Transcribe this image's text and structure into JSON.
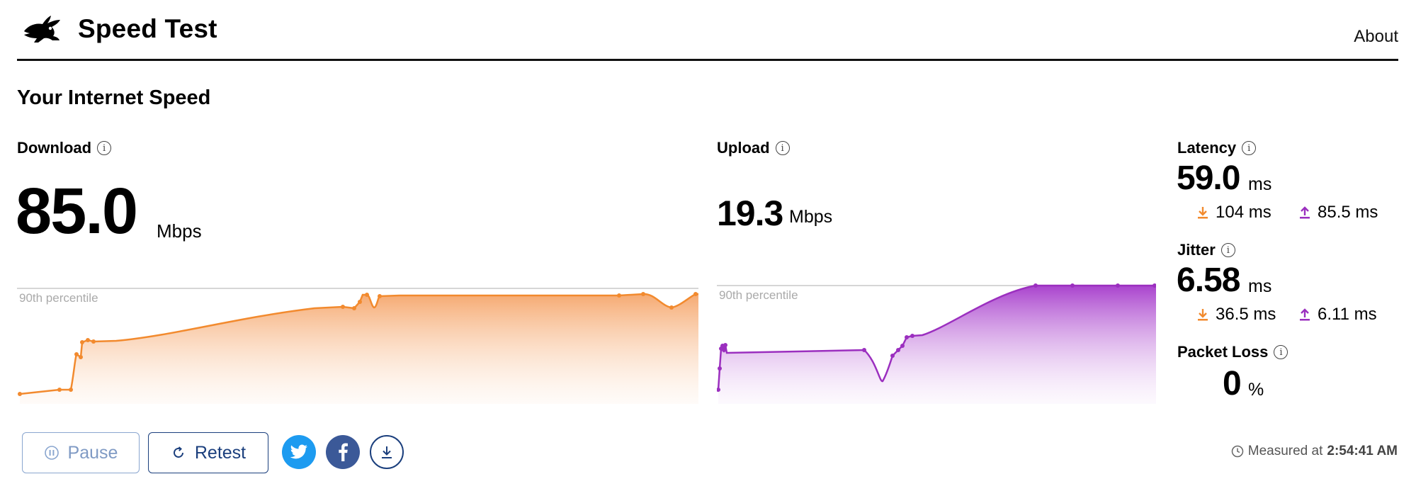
{
  "header": {
    "title": "Speed Test",
    "about_label": "About"
  },
  "main": {
    "section_title": "Your Internet Speed",
    "percentile_label": "90th percentile"
  },
  "download": {
    "label": "Download",
    "value": "85.0",
    "unit": "Mbps",
    "color": "#f28a2e"
  },
  "upload": {
    "label": "Upload",
    "value": "19.3",
    "unit": "Mbps",
    "color": "#9b2fbf"
  },
  "latency": {
    "label": "Latency",
    "value": "59.0",
    "unit": "ms",
    "down_value": "104 ms",
    "up_value": "85.5 ms"
  },
  "jitter": {
    "label": "Jitter",
    "value": "6.58",
    "unit": "ms",
    "down_value": "36.5 ms",
    "up_value": "6.11 ms"
  },
  "packet_loss": {
    "label": "Packet Loss",
    "value": "0",
    "unit": "%"
  },
  "actions": {
    "pause_label": "Pause",
    "retest_label": "Retest"
  },
  "footer": {
    "measured_prefix": "Measured at",
    "measured_time": "2:54:41 AM"
  },
  "icons": {
    "logo": "rabbit-icon",
    "info": "info-icon",
    "pause": "pause-icon",
    "retest": "refresh-icon",
    "twitter": "twitter-icon",
    "facebook": "facebook-icon",
    "download": "download-icon",
    "clock": "clock-icon"
  }
}
